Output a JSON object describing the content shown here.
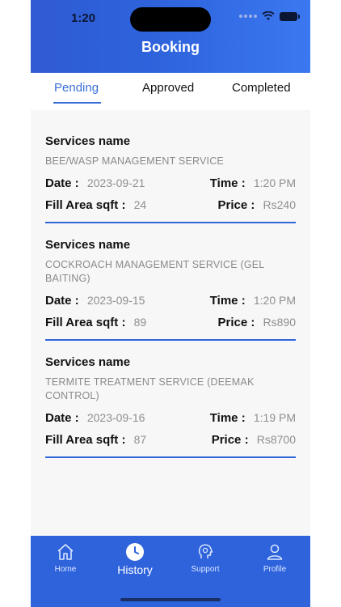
{
  "status": {
    "time": "1:20"
  },
  "header": {
    "title": "Booking"
  },
  "tabs": [
    {
      "label": "Pending",
      "active": true
    },
    {
      "label": "Approved",
      "active": false
    },
    {
      "label": "Completed",
      "active": false
    }
  ],
  "labels": {
    "services_name": "Services name",
    "date": "Date : ",
    "time": "Time : ",
    "area": "Fill Area sqft : ",
    "price": "Price : "
  },
  "bookings": [
    {
      "service": "BEE/WASP MANAGEMENT SERVICE",
      "date": "2023-09-21",
      "time": "1:20 PM",
      "area": "24",
      "price": "Rs240"
    },
    {
      "service": "COCKROACH MANAGEMENT SERVICE (GEL BAITING)",
      "date": "2023-09-15",
      "time": "1:20 PM",
      "area": "89",
      "price": "Rs890"
    },
    {
      "service": "TERMITE TREATMENT SERVICE (DEEMAK CONTROL)",
      "date": "2023-09-16",
      "time": "1:19 PM",
      "area": "87",
      "price": "Rs8700"
    }
  ],
  "nav": [
    {
      "label": "Home",
      "icon": "home-icon",
      "active": false
    },
    {
      "label": "History",
      "icon": "clock-icon",
      "active": true
    },
    {
      "label": "Support",
      "icon": "support-icon",
      "active": false
    },
    {
      "label": "Profile",
      "icon": "profile-icon",
      "active": false
    }
  ],
  "colors": {
    "accent": "#2e63dc",
    "tab_active": "#3a6fd8"
  }
}
